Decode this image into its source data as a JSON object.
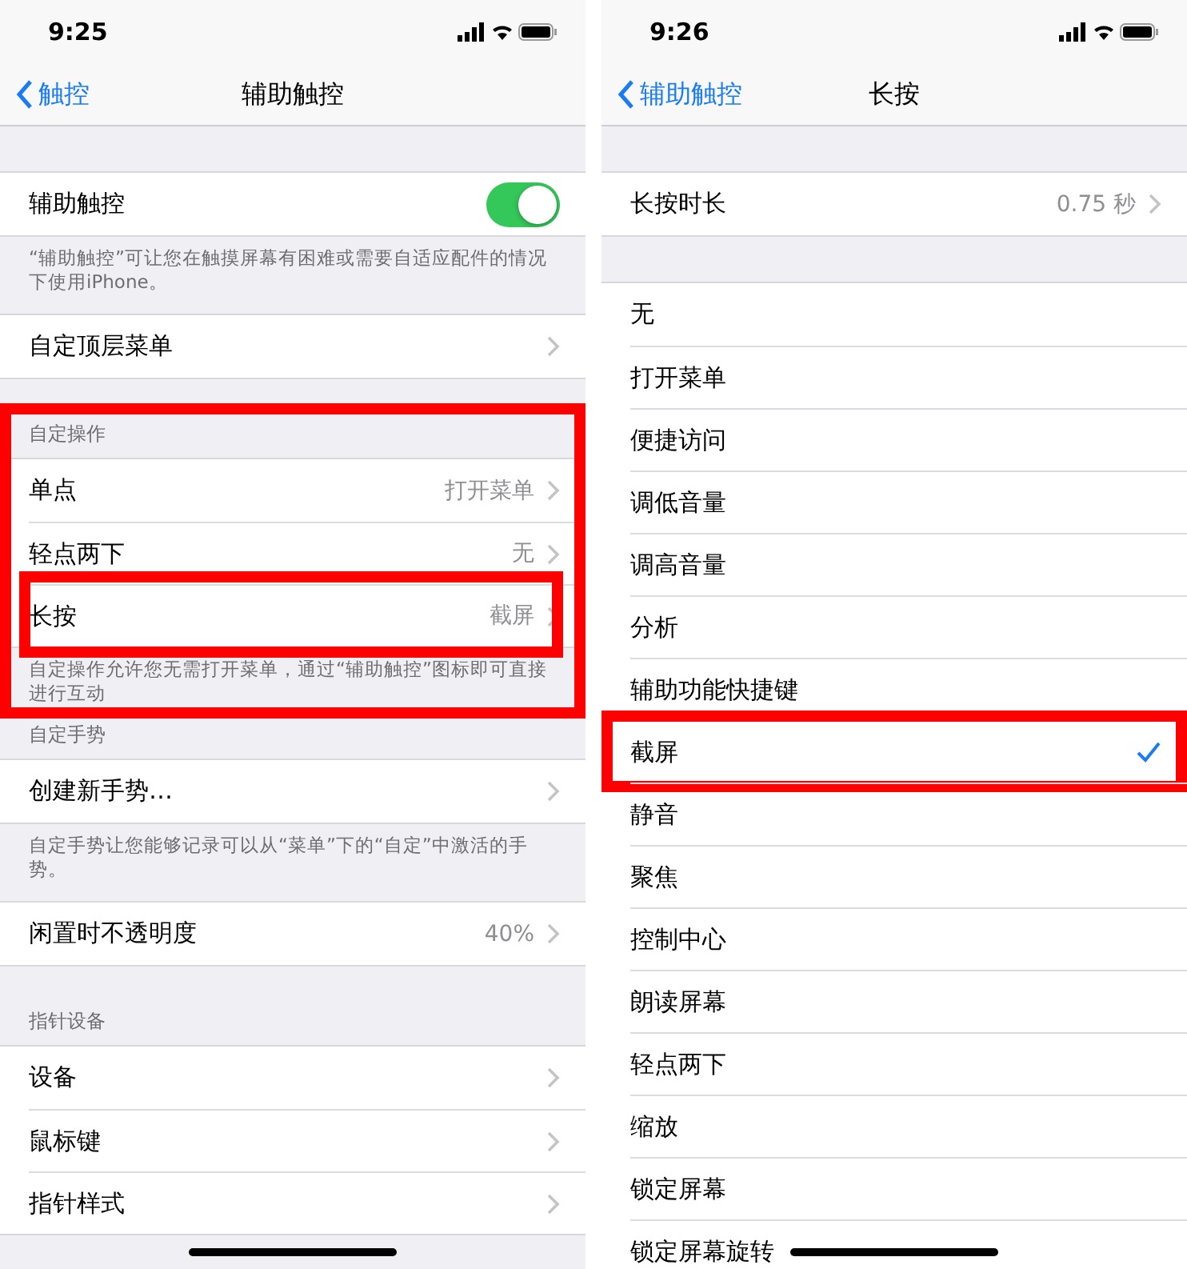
{
  "screens": [
    {
      "status_bar": {
        "time": "9:25"
      },
      "nav": {
        "back": "触控",
        "title": "辅助触控"
      },
      "groups": [
        {
          "highlighted": false,
          "rows": [
            {
              "kind": "toggle",
              "label": "辅助触控",
              "on": true,
              "highlighted": false
            }
          ],
          "footer": "“辅助触控”可让您在触摸屏幕有困难或需要自适应配件的情况下使用iPhone。"
        },
        {
          "highlighted": false,
          "rows": [
            {
              "kind": "link",
              "label": "自定顶层菜单",
              "highlighted": false
            }
          ]
        },
        {
          "highlighted": true,
          "header": "自定操作",
          "rows": [
            {
              "kind": "link",
              "label": "单点",
              "value": "打开菜单",
              "highlighted": false
            },
            {
              "kind": "link",
              "label": "轻点两下",
              "value": "无",
              "highlighted": false
            },
            {
              "kind": "link",
              "label": "长按",
              "value": "截屏",
              "highlighted": true
            }
          ],
          "footer": "自定操作允许您无需打开菜单，通过“辅助触控”图标即可直接进行互动"
        },
        {
          "highlighted": false,
          "header": "自定手势",
          "rows": [
            {
              "kind": "link",
              "label": "创建新手势…",
              "highlighted": false
            }
          ],
          "footer": "自定手势让您能够记录可以从“菜单”下的“自定”中激活的手势。"
        },
        {
          "highlighted": false,
          "rows": [
            {
              "kind": "link",
              "label": "闲置时不透明度",
              "value": "40%",
              "highlighted": false
            }
          ]
        },
        {
          "highlighted": false,
          "header": "指针设备",
          "rows": [
            {
              "kind": "link",
              "label": "设备",
              "highlighted": false
            },
            {
              "kind": "link",
              "label": "鼠标键",
              "highlighted": false
            },
            {
              "kind": "link",
              "label": "指针样式",
              "highlighted": false
            }
          ]
        }
      ]
    },
    {
      "status_bar": {
        "time": "9:26"
      },
      "nav": {
        "back": "辅助触控",
        "title": "长按"
      },
      "groups": [
        {
          "highlighted": false,
          "rows": [
            {
              "kind": "link",
              "label": "长按时长",
              "value": "0.75 秒",
              "highlighted": false
            }
          ]
        },
        {
          "highlighted": false,
          "rows": [
            {
              "kind": "option",
              "label": "无",
              "selected": false,
              "highlighted": false
            },
            {
              "kind": "option",
              "label": "打开菜单",
              "selected": false,
              "highlighted": false
            },
            {
              "kind": "option",
              "label": "便捷访问",
              "selected": false,
              "highlighted": false
            },
            {
              "kind": "option",
              "label": "调低音量",
              "selected": false,
              "highlighted": false
            },
            {
              "kind": "option",
              "label": "调高音量",
              "selected": false,
              "highlighted": false
            },
            {
              "kind": "option",
              "label": "分析",
              "selected": false,
              "highlighted": false
            },
            {
              "kind": "option",
              "label": "辅助功能快捷键",
              "selected": false,
              "highlighted": false
            },
            {
              "kind": "option",
              "label": "截屏",
              "selected": true,
              "highlighted": true
            },
            {
              "kind": "option",
              "label": "静音",
              "selected": false,
              "highlighted": false
            },
            {
              "kind": "option",
              "label": "聚焦",
              "selected": false,
              "highlighted": false
            },
            {
              "kind": "option",
              "label": "控制中心",
              "selected": false,
              "highlighted": false
            },
            {
              "kind": "option",
              "label": "朗读屏幕",
              "selected": false,
              "highlighted": false
            },
            {
              "kind": "option",
              "label": "轻点两下",
              "selected": false,
              "highlighted": false
            },
            {
              "kind": "option",
              "label": "缩放",
              "selected": false,
              "highlighted": false
            },
            {
              "kind": "option",
              "label": "锁定屏幕",
              "selected": false,
              "highlighted": false
            },
            {
              "kind": "option",
              "label": "锁定屏幕旋转",
              "selected": false,
              "highlighted": false
            }
          ]
        }
      ]
    }
  ]
}
